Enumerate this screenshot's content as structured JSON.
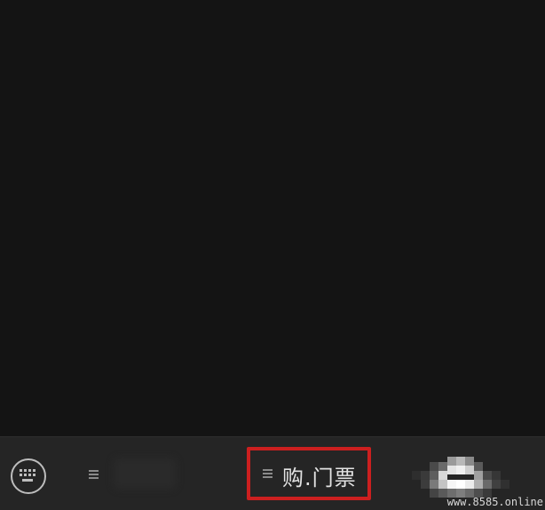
{
  "bottom_menu": {
    "keyboard_icon": "keyboard-icon",
    "items": [
      {
        "label": "",
        "icon": "hamburger-icon",
        "obscured": true
      },
      {
        "label": "购.门票",
        "icon": "hamburger-icon",
        "highlighted": true,
        "highlight_color": "#cc1f1f"
      },
      {
        "label": "",
        "obscured": true
      }
    ]
  },
  "watermark": "www.8585.online",
  "colors": {
    "background": "#141414",
    "menu_bar": "#252525",
    "text": "#e2e2e2",
    "highlight": "#cc1f1f"
  }
}
